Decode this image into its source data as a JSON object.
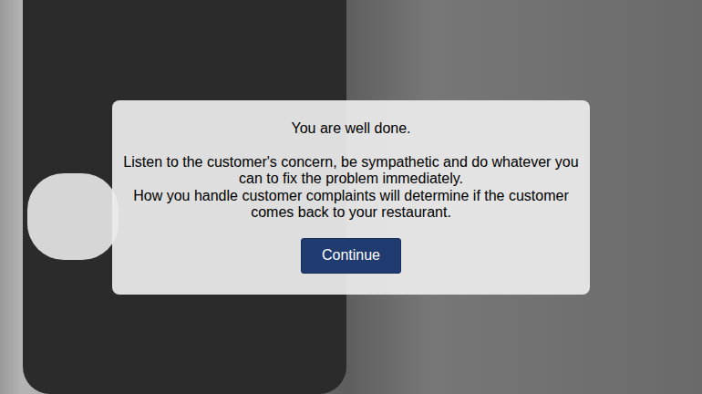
{
  "dialog": {
    "title": "You are well done.",
    "paragraphs": [
      "Listen to the customer's concern, be sympathetic and do whatever you can to fix the problem immediately.",
      "How you handle customer complaints will determine if the customer comes back to your restaurant."
    ],
    "button": "Continue"
  }
}
